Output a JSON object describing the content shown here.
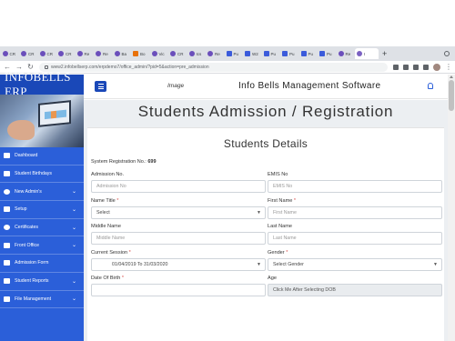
{
  "browser": {
    "tabs": [
      {
        "label": "CR",
        "type": "fb"
      },
      {
        "label": "CR",
        "type": "fb"
      },
      {
        "label": "CR",
        "type": "fb"
      },
      {
        "label": "CR",
        "type": "fb"
      },
      {
        "label": "Re",
        "type": "fb"
      },
      {
        "label": "Re",
        "type": "fb"
      },
      {
        "label": "Ba",
        "type": "fb"
      },
      {
        "label": "Bo",
        "type": "orange"
      },
      {
        "label": "Vic",
        "type": "fb"
      },
      {
        "label": "CR",
        "type": "fb"
      },
      {
        "label": "Ics",
        "type": "fb"
      },
      {
        "label": "Re",
        "type": "fb"
      },
      {
        "label": "Pu",
        "type": "w"
      },
      {
        "label": "W2",
        "type": "w"
      },
      {
        "label": "Pu",
        "type": "w"
      },
      {
        "label": "Pu",
        "type": "w"
      },
      {
        "label": "Pu",
        "type": "w"
      },
      {
        "label": "Pu",
        "type": "w"
      },
      {
        "label": "Re",
        "type": "fb"
      },
      {
        "label": "I",
        "type": "active"
      }
    ],
    "new_tab": "+",
    "url": "www2.infobellserp.com/erpdemo7/office_admin/?pid=5&action=pre_admission"
  },
  "sidebar": {
    "brand": "INFOBELLS ERP",
    "items": [
      {
        "label": "Dashboard",
        "icon": "grid-icon",
        "chevron": false
      },
      {
        "label": "Student Birthdays",
        "icon": "user-icon",
        "chevron": false
      },
      {
        "label": "New Admin's",
        "icon": "user-circle-icon",
        "chevron": true
      },
      {
        "label": "Setup",
        "icon": "gears-icon",
        "chevron": true
      },
      {
        "label": "Certificates",
        "icon": "circle-icon",
        "chevron": true
      },
      {
        "label": "Front Office",
        "icon": "monitor-icon",
        "chevron": true
      },
      {
        "label": "Admission Form",
        "icon": "form-icon",
        "chevron": false
      },
      {
        "label": "Student Reports",
        "icon": "report-icon",
        "chevron": true
      },
      {
        "label": "File Management",
        "icon": "file-icon",
        "chevron": true
      }
    ]
  },
  "header": {
    "image_alt": "Image",
    "title": "Info Bells Management Software"
  },
  "main": {
    "heading": "Students Admission / Registration",
    "card_title": "Students Details",
    "sysreg_label": "System Registration No.:",
    "sysreg_value": "699",
    "fields": {
      "admission_no": {
        "label": "Admission No.",
        "placeholder": "Admission No",
        "required": ""
      },
      "emis_no": {
        "label": "EMIS No",
        "placeholder": "EMIS No",
        "required": ""
      },
      "name_title": {
        "label": "Name Title",
        "value": "Select",
        "required": "*"
      },
      "first_name": {
        "label": "First Name",
        "placeholder": "First Name",
        "required": "*"
      },
      "middle_name": {
        "label": "Middle Name",
        "placeholder": "Middle Name",
        "required": ""
      },
      "last_name": {
        "label": "Last Name",
        "placeholder": "Last Name",
        "required": ""
      },
      "current_session": {
        "label": "Current Session",
        "value": "01/04/2019 To 31/03/2020",
        "required": "*"
      },
      "gender": {
        "label": "Gender",
        "value": "Select Gender",
        "required": "*"
      },
      "dob": {
        "label": "Date Of Birth",
        "placeholder": "",
        "required": "*"
      },
      "age": {
        "label": "Age",
        "placeholder": "Click Me After Selecting DOB",
        "required": ""
      }
    }
  }
}
